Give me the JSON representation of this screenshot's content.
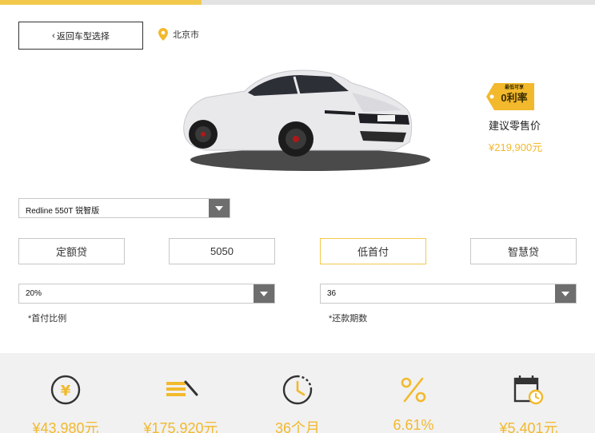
{
  "nav": {
    "back_label": "返回车型选择",
    "location": "北京市"
  },
  "promo": {
    "line1": "最低可享",
    "line2": "0利率"
  },
  "pricing": {
    "retail_label": "建议零售价",
    "retail_price": "¥219,900元"
  },
  "model_select": {
    "value": "Redline 550T 锐智版"
  },
  "plans": [
    {
      "label": "定额贷",
      "active": false
    },
    {
      "label": "5050",
      "active": false
    },
    {
      "label": "低首付",
      "active": true
    },
    {
      "label": "智慧贷",
      "active": false
    }
  ],
  "down_payment": {
    "value": "20%",
    "hint": "*首付比例"
  },
  "term": {
    "value": "36",
    "hint": "*还款期数"
  },
  "summary": [
    {
      "icon": "yen-circle-icon",
      "value": "¥43,980元"
    },
    {
      "icon": "loan-stack-icon",
      "value": "¥175,920元"
    },
    {
      "icon": "clock-icon",
      "value": "36个月"
    },
    {
      "icon": "percent-icon",
      "value": "6.61%"
    },
    {
      "icon": "calendar-clock-icon",
      "value": "¥5,401元"
    }
  ],
  "colors": {
    "accent": "#f2b92d",
    "accent_border": "#f2c94c",
    "panel_bg": "#f1f1f1"
  }
}
